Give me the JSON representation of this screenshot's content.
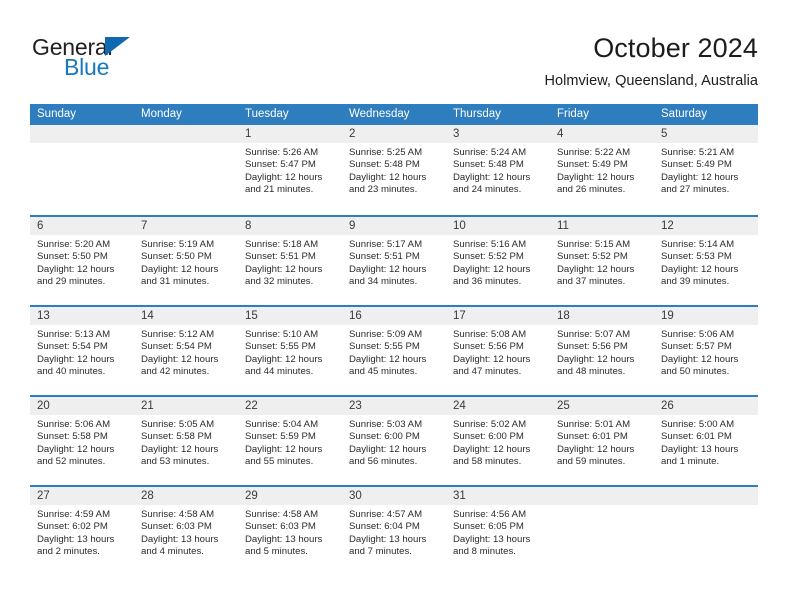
{
  "brand": {
    "name_part1": "General",
    "name_part2": "Blue",
    "triangle_color": "#1069b0",
    "blue_text_color": "#1878be"
  },
  "header": {
    "title": "October 2024",
    "subtitle": "Holmview, Queensland, Australia"
  },
  "theme": {
    "header_bar_color": "#2E7DBE",
    "day_band_color": "#EFEFEF",
    "text_color": "#2B2B2B"
  },
  "weekdays": [
    "Sunday",
    "Monday",
    "Tuesday",
    "Wednesday",
    "Thursday",
    "Friday",
    "Saturday"
  ],
  "weeks": [
    [
      {
        "day": "",
        "empty": true
      },
      {
        "day": "",
        "empty": true
      },
      {
        "day": "1",
        "sunrise": "Sunrise: 5:26 AM",
        "sunset": "Sunset: 5:47 PM",
        "daylight1": "Daylight: 12 hours",
        "daylight2": "and 21 minutes."
      },
      {
        "day": "2",
        "sunrise": "Sunrise: 5:25 AM",
        "sunset": "Sunset: 5:48 PM",
        "daylight1": "Daylight: 12 hours",
        "daylight2": "and 23 minutes."
      },
      {
        "day": "3",
        "sunrise": "Sunrise: 5:24 AM",
        "sunset": "Sunset: 5:48 PM",
        "daylight1": "Daylight: 12 hours",
        "daylight2": "and 24 minutes."
      },
      {
        "day": "4",
        "sunrise": "Sunrise: 5:22 AM",
        "sunset": "Sunset: 5:49 PM",
        "daylight1": "Daylight: 12 hours",
        "daylight2": "and 26 minutes."
      },
      {
        "day": "5",
        "sunrise": "Sunrise: 5:21 AM",
        "sunset": "Sunset: 5:49 PM",
        "daylight1": "Daylight: 12 hours",
        "daylight2": "and 27 minutes."
      }
    ],
    [
      {
        "day": "6",
        "sunrise": "Sunrise: 5:20 AM",
        "sunset": "Sunset: 5:50 PM",
        "daylight1": "Daylight: 12 hours",
        "daylight2": "and 29 minutes."
      },
      {
        "day": "7",
        "sunrise": "Sunrise: 5:19 AM",
        "sunset": "Sunset: 5:50 PM",
        "daylight1": "Daylight: 12 hours",
        "daylight2": "and 31 minutes."
      },
      {
        "day": "8",
        "sunrise": "Sunrise: 5:18 AM",
        "sunset": "Sunset: 5:51 PM",
        "daylight1": "Daylight: 12 hours",
        "daylight2": "and 32 minutes."
      },
      {
        "day": "9",
        "sunrise": "Sunrise: 5:17 AM",
        "sunset": "Sunset: 5:51 PM",
        "daylight1": "Daylight: 12 hours",
        "daylight2": "and 34 minutes."
      },
      {
        "day": "10",
        "sunrise": "Sunrise: 5:16 AM",
        "sunset": "Sunset: 5:52 PM",
        "daylight1": "Daylight: 12 hours",
        "daylight2": "and 36 minutes."
      },
      {
        "day": "11",
        "sunrise": "Sunrise: 5:15 AM",
        "sunset": "Sunset: 5:52 PM",
        "daylight1": "Daylight: 12 hours",
        "daylight2": "and 37 minutes."
      },
      {
        "day": "12",
        "sunrise": "Sunrise: 5:14 AM",
        "sunset": "Sunset: 5:53 PM",
        "daylight1": "Daylight: 12 hours",
        "daylight2": "and 39 minutes."
      }
    ],
    [
      {
        "day": "13",
        "sunrise": "Sunrise: 5:13 AM",
        "sunset": "Sunset: 5:54 PM",
        "daylight1": "Daylight: 12 hours",
        "daylight2": "and 40 minutes."
      },
      {
        "day": "14",
        "sunrise": "Sunrise: 5:12 AM",
        "sunset": "Sunset: 5:54 PM",
        "daylight1": "Daylight: 12 hours",
        "daylight2": "and 42 minutes."
      },
      {
        "day": "15",
        "sunrise": "Sunrise: 5:10 AM",
        "sunset": "Sunset: 5:55 PM",
        "daylight1": "Daylight: 12 hours",
        "daylight2": "and 44 minutes."
      },
      {
        "day": "16",
        "sunrise": "Sunrise: 5:09 AM",
        "sunset": "Sunset: 5:55 PM",
        "daylight1": "Daylight: 12 hours",
        "daylight2": "and 45 minutes."
      },
      {
        "day": "17",
        "sunrise": "Sunrise: 5:08 AM",
        "sunset": "Sunset: 5:56 PM",
        "daylight1": "Daylight: 12 hours",
        "daylight2": "and 47 minutes."
      },
      {
        "day": "18",
        "sunrise": "Sunrise: 5:07 AM",
        "sunset": "Sunset: 5:56 PM",
        "daylight1": "Daylight: 12 hours",
        "daylight2": "and 48 minutes."
      },
      {
        "day": "19",
        "sunrise": "Sunrise: 5:06 AM",
        "sunset": "Sunset: 5:57 PM",
        "daylight1": "Daylight: 12 hours",
        "daylight2": "and 50 minutes."
      }
    ],
    [
      {
        "day": "20",
        "sunrise": "Sunrise: 5:06 AM",
        "sunset": "Sunset: 5:58 PM",
        "daylight1": "Daylight: 12 hours",
        "daylight2": "and 52 minutes."
      },
      {
        "day": "21",
        "sunrise": "Sunrise: 5:05 AM",
        "sunset": "Sunset: 5:58 PM",
        "daylight1": "Daylight: 12 hours",
        "daylight2": "and 53 minutes."
      },
      {
        "day": "22",
        "sunrise": "Sunrise: 5:04 AM",
        "sunset": "Sunset: 5:59 PM",
        "daylight1": "Daylight: 12 hours",
        "daylight2": "and 55 minutes."
      },
      {
        "day": "23",
        "sunrise": "Sunrise: 5:03 AM",
        "sunset": "Sunset: 6:00 PM",
        "daylight1": "Daylight: 12 hours",
        "daylight2": "and 56 minutes."
      },
      {
        "day": "24",
        "sunrise": "Sunrise: 5:02 AM",
        "sunset": "Sunset: 6:00 PM",
        "daylight1": "Daylight: 12 hours",
        "daylight2": "and 58 minutes."
      },
      {
        "day": "25",
        "sunrise": "Sunrise: 5:01 AM",
        "sunset": "Sunset: 6:01 PM",
        "daylight1": "Daylight: 12 hours",
        "daylight2": "and 59 minutes."
      },
      {
        "day": "26",
        "sunrise": "Sunrise: 5:00 AM",
        "sunset": "Sunset: 6:01 PM",
        "daylight1": "Daylight: 13 hours",
        "daylight2": "and 1 minute."
      }
    ],
    [
      {
        "day": "27",
        "sunrise": "Sunrise: 4:59 AM",
        "sunset": "Sunset: 6:02 PM",
        "daylight1": "Daylight: 13 hours",
        "daylight2": "and 2 minutes."
      },
      {
        "day": "28",
        "sunrise": "Sunrise: 4:58 AM",
        "sunset": "Sunset: 6:03 PM",
        "daylight1": "Daylight: 13 hours",
        "daylight2": "and 4 minutes."
      },
      {
        "day": "29",
        "sunrise": "Sunrise: 4:58 AM",
        "sunset": "Sunset: 6:03 PM",
        "daylight1": "Daylight: 13 hours",
        "daylight2": "and 5 minutes."
      },
      {
        "day": "30",
        "sunrise": "Sunrise: 4:57 AM",
        "sunset": "Sunset: 6:04 PM",
        "daylight1": "Daylight: 13 hours",
        "daylight2": "and 7 minutes."
      },
      {
        "day": "31",
        "sunrise": "Sunrise: 4:56 AM",
        "sunset": "Sunset: 6:05 PM",
        "daylight1": "Daylight: 13 hours",
        "daylight2": "and 8 minutes."
      },
      {
        "day": "",
        "empty": true
      },
      {
        "day": "",
        "empty": true
      }
    ]
  ]
}
